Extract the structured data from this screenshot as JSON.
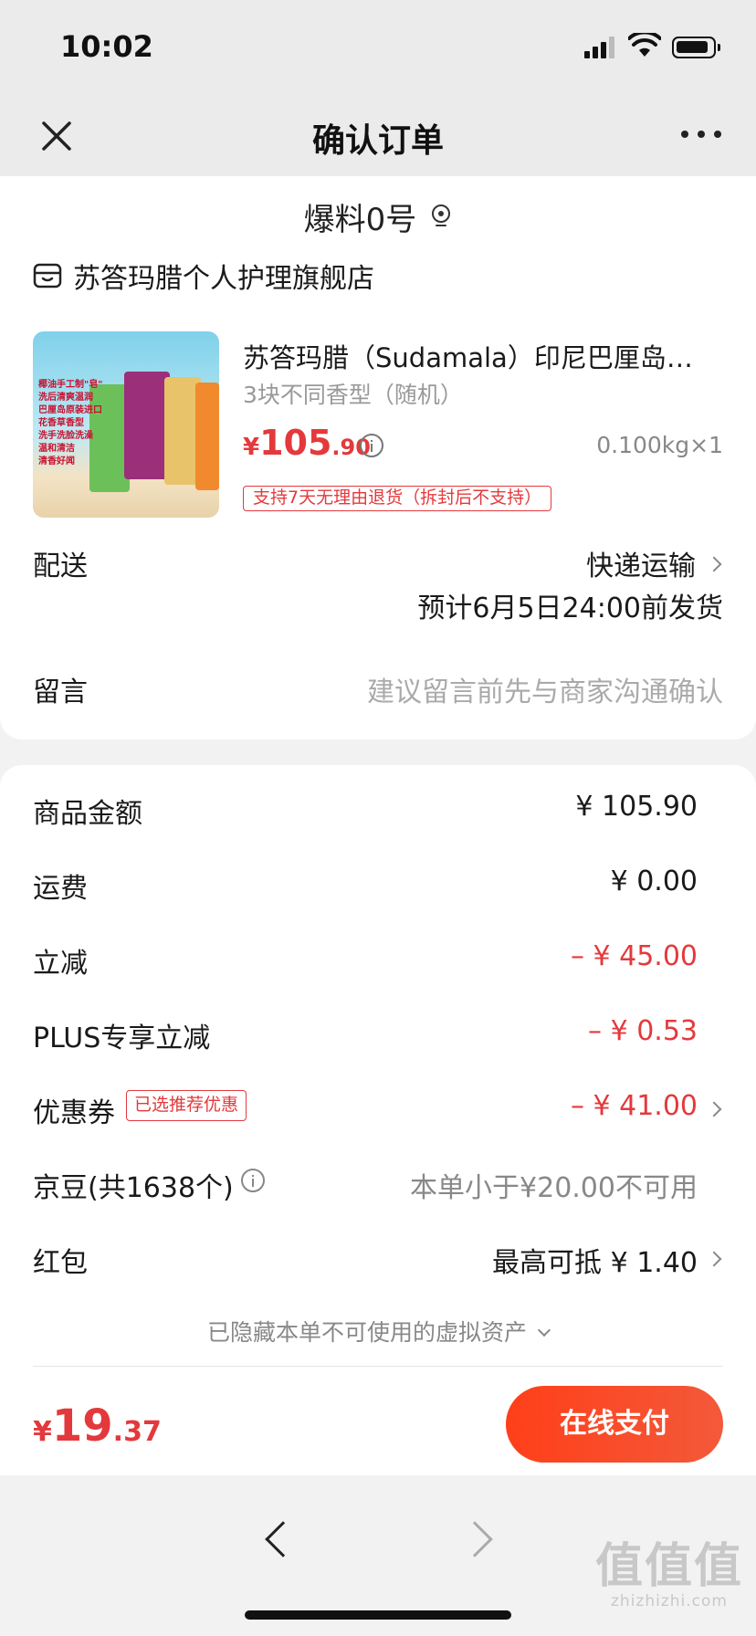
{
  "status_bar": {
    "time": "10:02"
  },
  "nav": {
    "title": "确认订单"
  },
  "address": {
    "name": "爆料0号"
  },
  "store": {
    "name": "苏答玛腊个人护理旗舰店"
  },
  "product": {
    "title": "苏答玛腊（Sudamala）印尼巴厘岛…",
    "spec": "3块不同香型（随机）",
    "price_currency": "¥",
    "price_int": "105",
    "price_dec": ".90",
    "weight_qty": "0.100kg×1",
    "return_policy": "支持7天无理由退货（拆封后不支持）",
    "image_text": [
      "椰油手工制\"皂\"",
      "洗后清爽温润",
      "巴厘岛原装进口",
      "花香草香型",
      "洗手洗脸洗澡",
      "温和清洁",
      "清香好闻"
    ]
  },
  "delivery": {
    "label": "配送",
    "method": "快递运输",
    "estimate": "预计6月5日24:00前发货"
  },
  "note": {
    "label": "留言",
    "placeholder": "建议留言前先与商家沟通确认"
  },
  "fees": {
    "goods_amount": {
      "label": "商品金额",
      "value": "¥ 105.90"
    },
    "shipping": {
      "label": "运费",
      "value": "¥ 0.00"
    },
    "instant_discount": {
      "label": "立减",
      "value": "– ¥ 45.00"
    },
    "plus_discount": {
      "label": "PLUS专享立减",
      "value": "– ¥ 0.53"
    },
    "coupon": {
      "label": "优惠券",
      "tag": "已选推荐优惠",
      "value": "– ¥ 41.00"
    },
    "jd_beans": {
      "label": "京豆(共1638个)",
      "value": "本单小于¥20.00不可用"
    },
    "red_packet": {
      "label": "红包",
      "value": "最高可抵 ¥ 1.40"
    },
    "hidden_assets": "已隐藏本单不可使用的虚拟资产"
  },
  "total": {
    "currency": "¥",
    "int": "19",
    "dec": ".37"
  },
  "pay_button": "在线支付",
  "watermark": {
    "big": "值值值",
    "small": "zhizhizhi.com"
  },
  "colors": {
    "accent": "#e4393c",
    "pay_button": "#ff3f19"
  }
}
